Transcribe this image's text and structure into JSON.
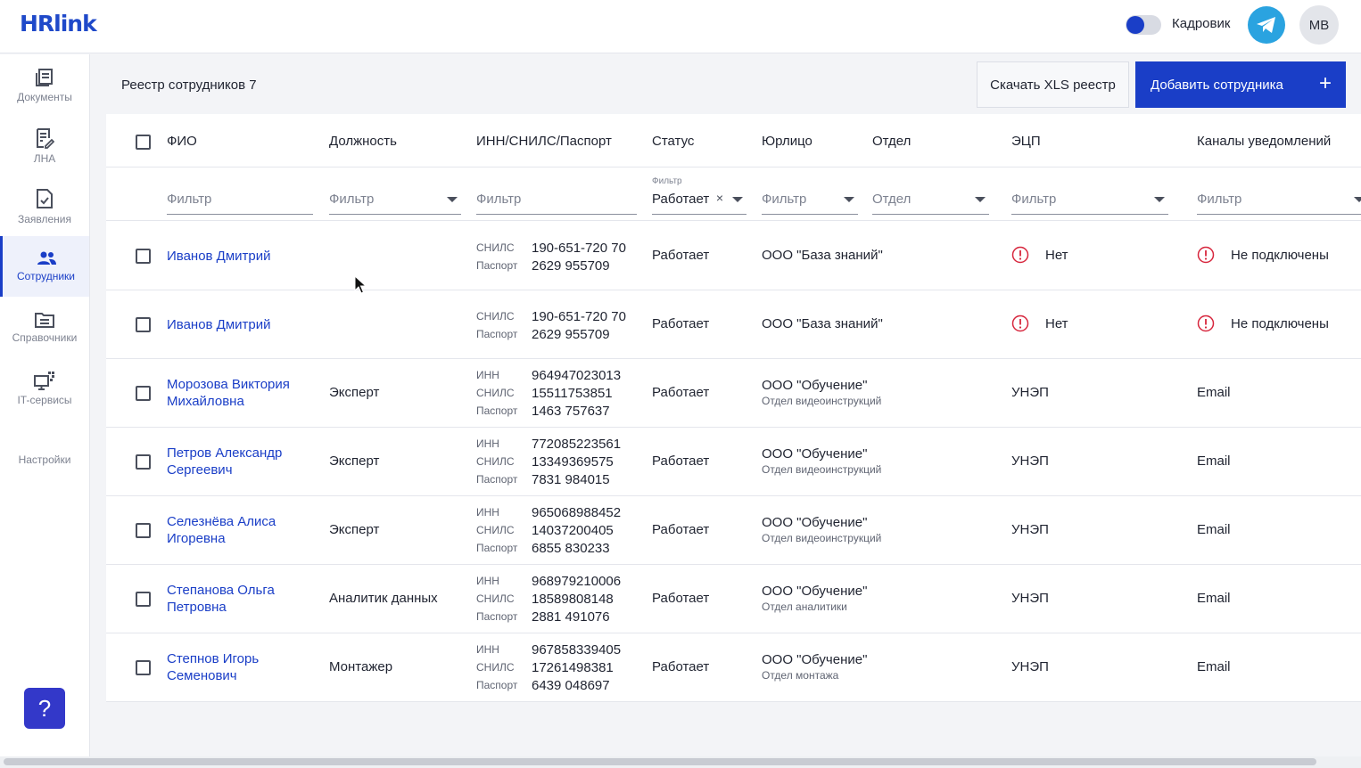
{
  "app": {
    "logo": "HRlink",
    "role_label": "Кадровик",
    "avatar_initials": "МВ"
  },
  "colors": {
    "accent": "#1a3ec7",
    "help_button": "#3338c9",
    "telegram": "#2aa3e0",
    "warning": "#d7263d"
  },
  "sidebar": {
    "items": [
      {
        "label": "Документы",
        "icon": "documents-icon"
      },
      {
        "label": "ЛНА",
        "icon": "lna-icon"
      },
      {
        "label": "Заявления",
        "icon": "applications-icon"
      },
      {
        "label": "Сотрудники",
        "icon": "employees-icon",
        "active": true
      },
      {
        "label": "Справочники",
        "icon": "folder-icon"
      },
      {
        "label": "IT-сервисы",
        "icon": "it-services-icon"
      },
      {
        "label": "Настройки",
        "icon": ""
      }
    ],
    "help_label": "?"
  },
  "header": {
    "title": "Реестр сотрудников 7",
    "download_button": "Скачать XLS реестр",
    "add_button": "Добавить сотрудника",
    "add_icon": "+"
  },
  "table": {
    "columns": [
      "ФИО",
      "Должность",
      "ИНН/СНИЛС/Паспорт",
      "Статус",
      "Юрлицо",
      "Отдел",
      "ЭЦП",
      "Каналы уведомлений"
    ],
    "filters": {
      "fio": "Фильтр",
      "position": "Фильтр",
      "ids": "Фильтр",
      "status_caption": "Фильтр",
      "status_value": "Работает",
      "status_clear": "×",
      "legal": "Фильтр",
      "department": "Отдел",
      "signature": "Фильтр",
      "channels": "Фильтр"
    },
    "rows": [
      {
        "name": "Иванов Дмитрий",
        "position": "",
        "ids": [
          {
            "label": "СНИЛС",
            "value": "190-651-720 70"
          },
          {
            "label": "Паспорт",
            "value": "2629 955709"
          }
        ],
        "status": "Работает",
        "org": "ООО \"База знаний\"",
        "dept": "",
        "signature": "Нет",
        "signature_warning": true,
        "channels": "Не подключены",
        "channels_warning": true
      },
      {
        "name": "Иванов Дмитрий",
        "position": "",
        "ids": [
          {
            "label": "СНИЛС",
            "value": "190-651-720 70"
          },
          {
            "label": "Паспорт",
            "value": "2629 955709"
          }
        ],
        "status": "Работает",
        "org": "ООО \"База знаний\"",
        "dept": "",
        "signature": "Нет",
        "signature_warning": true,
        "channels": "Не подключены",
        "channels_warning": true
      },
      {
        "name": "Морозова Виктория Михайловна",
        "position": "Эксперт",
        "ids": [
          {
            "label": "ИНН",
            "value": "964947023013"
          },
          {
            "label": "СНИЛС",
            "value": "15511753851"
          },
          {
            "label": "Паспорт",
            "value": "1463 757637"
          }
        ],
        "status": "Работает",
        "org": "ООО \"Обучение\"",
        "dept": "Отдел видеоинструкций",
        "signature": "УНЭП",
        "signature_warning": false,
        "channels": "Email",
        "channels_warning": false
      },
      {
        "name": "Петров Александр Сергеевич",
        "position": "Эксперт",
        "ids": [
          {
            "label": "ИНН",
            "value": "772085223561"
          },
          {
            "label": "СНИЛС",
            "value": "13349369575"
          },
          {
            "label": "Паспорт",
            "value": "7831 984015"
          }
        ],
        "status": "Работает",
        "org": "ООО \"Обучение\"",
        "dept": "Отдел видеоинструкций",
        "signature": "УНЭП",
        "signature_warning": false,
        "channels": "Email",
        "channels_warning": false
      },
      {
        "name": "Селезнёва Алиса Игоревна",
        "position": "Эксперт",
        "ids": [
          {
            "label": "ИНН",
            "value": "965068988452"
          },
          {
            "label": "СНИЛС",
            "value": "14037200405"
          },
          {
            "label": "Паспорт",
            "value": "6855 830233"
          }
        ],
        "status": "Работает",
        "org": "ООО \"Обучение\"",
        "dept": "Отдел видеоинструкций",
        "signature": "УНЭП",
        "signature_warning": false,
        "channels": "Email",
        "channels_warning": false
      },
      {
        "name": "Степанова Ольга Петровна",
        "position": "Аналитик данных",
        "ids": [
          {
            "label": "ИНН",
            "value": "968979210006"
          },
          {
            "label": "СНИЛС",
            "value": "18589808148"
          },
          {
            "label": "Паспорт",
            "value": "2881 491076"
          }
        ],
        "status": "Работает",
        "org": "ООО \"Обучение\"",
        "dept": "Отдел аналитики",
        "signature": "УНЭП",
        "signature_warning": false,
        "channels": "Email",
        "channels_warning": false
      },
      {
        "name": "Степнов Игорь Семенович",
        "position": "Монтажер",
        "ids": [
          {
            "label": "ИНН",
            "value": "967858339405"
          },
          {
            "label": "СНИЛС",
            "value": "17261498381"
          },
          {
            "label": "Паспорт",
            "value": "6439 048697"
          }
        ],
        "status": "Работает",
        "org": "ООО \"Обучение\"",
        "dept": "Отдел монтажа",
        "signature": "УНЭП",
        "signature_warning": false,
        "channels": "Email",
        "channels_warning": false
      }
    ]
  }
}
